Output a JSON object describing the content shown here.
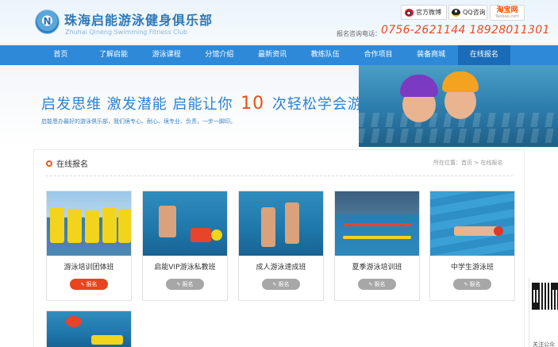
{
  "header": {
    "logo_mark": "N",
    "title": "珠海启能游泳健身俱乐部",
    "subtitle": "Zhuhai Qineng Swimming Fitness Club",
    "weibo_label": "官方微博",
    "qq_label": "QQ咨询",
    "taobao_label": "淘宝网",
    "taobao_sub": "Taobao.com",
    "phone_label": "报名咨询电话：",
    "phone": "0756-2621144 18928011301"
  },
  "nav": {
    "items": [
      "首页",
      "了解启能",
      "游泳课程",
      "分馆介绍",
      "最新资讯",
      "教练队伍",
      "合作项目",
      "装备商城",
      "在线报名"
    ],
    "active": "在线报名"
  },
  "banner": {
    "main_part1": "启发思维  激发潜能   启能让你 ",
    "main_number": "10",
    "main_part2": " 次轻松学会游泳",
    "sub": "启能恩办最好的游泳俱乐部，我们境专心、耐心、境专业、负责，一步一脚印。"
  },
  "section": {
    "title": "在线报名",
    "breadcrumb": "所在位置：首页  >  在线报名"
  },
  "courses": [
    {
      "name": "游泳培训团体班",
      "button": "报名",
      "highlight": true
    },
    {
      "name": "启能VIP游泳私教班",
      "button": "报名",
      "highlight": false
    },
    {
      "name": "成人游泳速成班",
      "button": "报名",
      "highlight": false
    },
    {
      "name": "夏季游泳培训班",
      "button": "报名",
      "highlight": false
    },
    {
      "name": "中学生游泳班",
      "button": "报名",
      "highlight": false
    }
  ],
  "qr": {
    "caption": "关注公众"
  },
  "colors": {
    "nav_blue": "#2e8ad9",
    "nav_active": "#1a6cb8",
    "accent_orange": "#e8441d",
    "brand_blue": "#2b82cf"
  }
}
